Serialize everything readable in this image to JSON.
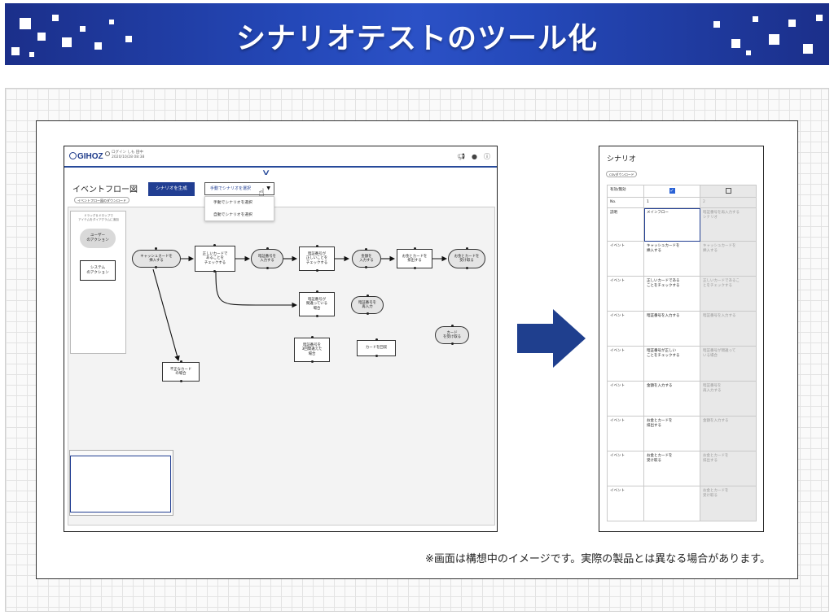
{
  "banner": {
    "title": "シナリオテストのツール化"
  },
  "app": {
    "logo": "GIHOZ",
    "login_line1": "ログイン しも 田中",
    "login_line2": "2020/10/28 08:38",
    "page_title": "イベントフロー図",
    "download_chip": "イベントフロー図のダウンロード",
    "generate_button": "シナリオを生成",
    "manual_select": "手動でシナリオを選択",
    "dropdown_options": [
      "手動でシナリオを選択",
      "自動でシナリオを選択"
    ],
    "palette_hint": "ドラッグ＆ドロップで\nアイテムをダイアグラムに追加",
    "palette_user_action": "ユーザー\nのアクション",
    "palette_system_action": "システム\nのアクション",
    "nodes": {
      "n1": "キャッシュカードを\n挿入する",
      "n2": "正しいカードで\nあることを\nチェックする",
      "n3": "暗証番号を\n入力する",
      "n4": "暗証番号が\n正しいことを\nチェックする",
      "n5": "金額を\n入力する",
      "n6": "お金とカードを\n排出する",
      "n7": "お金とカードを\n受け取る",
      "n8": "暗証番号が\n間違っている\n場合",
      "n9": "暗証番号を\n再入力",
      "n10": "暗証番号を\n3回間違えた\n場合",
      "n11": "カードを回収",
      "n12": "カード\nを受け取る",
      "n13": "不正なカード\nの場合"
    }
  },
  "scenario": {
    "title": "シナリオ",
    "csv_chip": "CSVダウンロード",
    "labels": {
      "valid": "有効/無効",
      "no": "No.",
      "desc": "説明",
      "event": "イベント"
    },
    "nos": [
      "1",
      "2"
    ],
    "col1": {
      "desc": "メインフロー",
      "events": [
        "キャッシュカードを\n挿入する",
        "正しいカードである\nことをチェックする",
        "暗証番号を入力する",
        "暗証番号が正しい\nことをチェックする",
        "金額を入力する",
        "お金とカードを\n排出する",
        "お金とカードを\n受け取る",
        ""
      ]
    },
    "col2": {
      "desc": "暗証番号を再入力する\nシナリオ",
      "events": [
        "キャッシュカードを\n挿入する",
        "正しいカードであるこ\nとをチェックする",
        "暗証番号を入力する",
        "暗証番号が間違って\nいる場合",
        "暗証番号を\n再入力する",
        "金額を入力する",
        "お金とカードを\n排出する",
        "お金とカードを\n受け取る"
      ]
    }
  },
  "disclaimer": "※画面は構想中のイメージです。実際の製品とは異なる場合があります。"
}
